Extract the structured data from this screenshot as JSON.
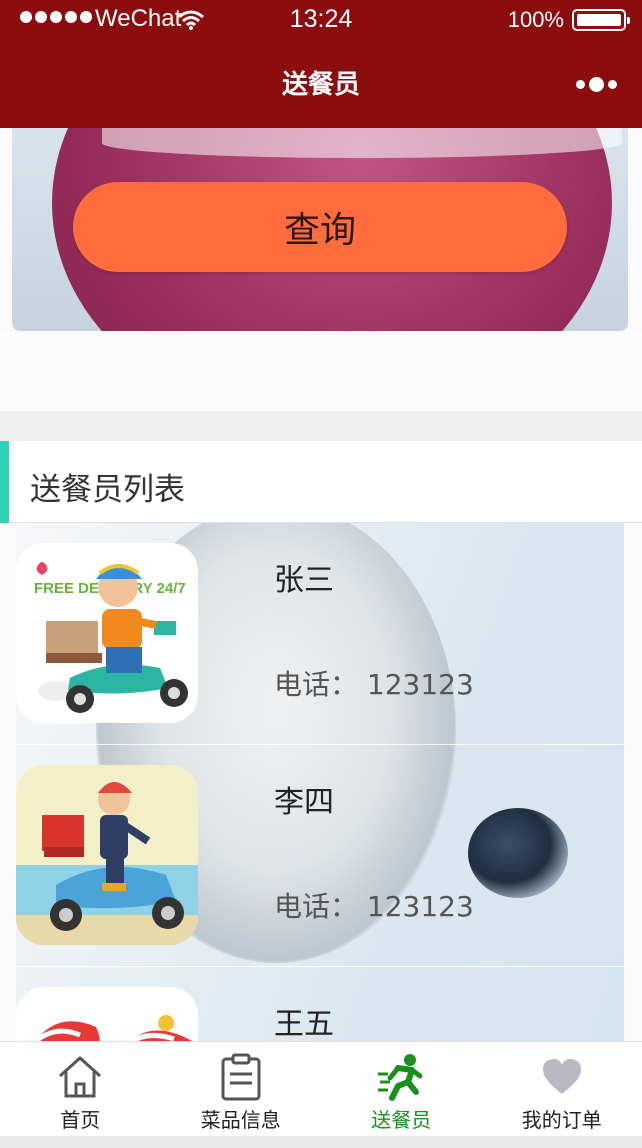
{
  "status_bar": {
    "carrier": "WeChat",
    "time": "13:24",
    "battery": "100%"
  },
  "nav": {
    "title": "送餐员"
  },
  "banner": {
    "query_label": "查询"
  },
  "section": {
    "title": "送餐员列表"
  },
  "couriers": [
    {
      "name": "张三",
      "phone": "电话： 123123",
      "avatar_text": "FREE DELIVERY 24/7"
    },
    {
      "name": "李四",
      "phone": "电话： 123123"
    },
    {
      "name": "王五"
    }
  ],
  "tabs": [
    {
      "label": "首页",
      "icon": "home-icon"
    },
    {
      "label": "菜品信息",
      "icon": "clipboard-icon"
    },
    {
      "label": "送餐员",
      "icon": "running-courier-icon",
      "active": true
    },
    {
      "label": "我的订单",
      "icon": "heart-icon"
    }
  ],
  "colors": {
    "nav_bg": "#8b0d0e",
    "query_button": "#ff6d3f",
    "section_accent": "#2fd1b4",
    "active_tab": "#1a8f1a"
  }
}
